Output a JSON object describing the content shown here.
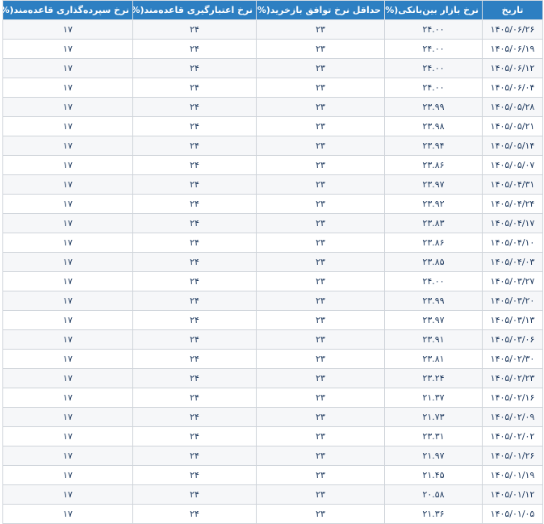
{
  "table": {
    "headers": {
      "date": "تاریخ",
      "interbank": "نرخ بازار بین‌بانکی(%)",
      "repo_min": "حداقل نرخ توافق بازخرید(%)",
      "credit": "نرخ اعتبارگیری قاعده‌مند(%)",
      "deposit": "نرخ سپرده‌گذاری قاعده‌مند(%)"
    },
    "rows": [
      {
        "date": "۱۴۰۵/۰۶/۲۶",
        "interbank": "۲۴.۰۰",
        "repo_min": "۲۳",
        "credit": "۲۴",
        "deposit": "۱۷"
      },
      {
        "date": "۱۴۰۵/۰۶/۱۹",
        "interbank": "۲۴.۰۰",
        "repo_min": "۲۳",
        "credit": "۲۴",
        "deposit": "۱۷"
      },
      {
        "date": "۱۴۰۵/۰۶/۱۲",
        "interbank": "۲۴.۰۰",
        "repo_min": "۲۳",
        "credit": "۲۴",
        "deposit": "۱۷"
      },
      {
        "date": "۱۴۰۵/۰۶/۰۴",
        "interbank": "۲۴.۰۰",
        "repo_min": "۲۳",
        "credit": "۲۴",
        "deposit": "۱۷"
      },
      {
        "date": "۱۴۰۵/۰۵/۲۸",
        "interbank": "۲۳.۹۹",
        "repo_min": "۲۳",
        "credit": "۲۴",
        "deposit": "۱۷"
      },
      {
        "date": "۱۴۰۵/۰۵/۲۱",
        "interbank": "۲۳.۹۸",
        "repo_min": "۲۳",
        "credit": "۲۴",
        "deposit": "۱۷"
      },
      {
        "date": "۱۴۰۵/۰۵/۱۴",
        "interbank": "۲۳.۹۴",
        "repo_min": "۲۳",
        "credit": "۲۴",
        "deposit": "۱۷"
      },
      {
        "date": "۱۴۰۵/۰۵/۰۷",
        "interbank": "۲۳.۸۶",
        "repo_min": "۲۳",
        "credit": "۲۴",
        "deposit": "۱۷"
      },
      {
        "date": "۱۴۰۵/۰۴/۳۱",
        "interbank": "۲۳.۹۷",
        "repo_min": "۲۳",
        "credit": "۲۴",
        "deposit": "۱۷"
      },
      {
        "date": "۱۴۰۵/۰۴/۲۴",
        "interbank": "۲۳.۹۲",
        "repo_min": "۲۳",
        "credit": "۲۴",
        "deposit": "۱۷"
      },
      {
        "date": "۱۴۰۵/۰۴/۱۷",
        "interbank": "۲۳.۸۳",
        "repo_min": "۲۳",
        "credit": "۲۴",
        "deposit": "۱۷"
      },
      {
        "date": "۱۴۰۵/۰۴/۱۰",
        "interbank": "۲۳.۸۶",
        "repo_min": "۲۳",
        "credit": "۲۴",
        "deposit": "۱۷"
      },
      {
        "date": "۱۴۰۵/۰۴/۰۳",
        "interbank": "۲۳.۸۵",
        "repo_min": "۲۳",
        "credit": "۲۴",
        "deposit": "۱۷"
      },
      {
        "date": "۱۴۰۵/۰۳/۲۷",
        "interbank": "۲۴.۰۰",
        "repo_min": "۲۳",
        "credit": "۲۴",
        "deposit": "۱۷"
      },
      {
        "date": "۱۴۰۵/۰۳/۲۰",
        "interbank": "۲۳.۹۹",
        "repo_min": "۲۳",
        "credit": "۲۴",
        "deposit": "۱۷"
      },
      {
        "date": "۱۴۰۵/۰۳/۱۳",
        "interbank": "۲۳.۹۷",
        "repo_min": "۲۳",
        "credit": "۲۴",
        "deposit": "۱۷"
      },
      {
        "date": "۱۴۰۵/۰۳/۰۶",
        "interbank": "۲۳.۹۱",
        "repo_min": "۲۳",
        "credit": "۲۴",
        "deposit": "۱۷"
      },
      {
        "date": "۱۴۰۵/۰۲/۳۰",
        "interbank": "۲۳.۸۱",
        "repo_min": "۲۳",
        "credit": "۲۴",
        "deposit": "۱۷"
      },
      {
        "date": "۱۴۰۵/۰۲/۲۳",
        "interbank": "۲۳.۲۴",
        "repo_min": "۲۳",
        "credit": "۲۴",
        "deposit": "۱۷"
      },
      {
        "date": "۱۴۰۵/۰۲/۱۶",
        "interbank": "۲۱.۳۷",
        "repo_min": "۲۳",
        "credit": "۲۴",
        "deposit": "۱۷"
      },
      {
        "date": "۱۴۰۵/۰۲/۰۹",
        "interbank": "۲۱.۷۳",
        "repo_min": "۲۳",
        "credit": "۲۴",
        "deposit": "۱۷"
      },
      {
        "date": "۱۴۰۵/۰۲/۰۲",
        "interbank": "۲۳.۳۱",
        "repo_min": "۲۳",
        "credit": "۲۴",
        "deposit": "۱۷"
      },
      {
        "date": "۱۴۰۵/۰۱/۲۶",
        "interbank": "۲۱.۹۷",
        "repo_min": "۲۳",
        "credit": "۲۴",
        "deposit": "۱۷"
      },
      {
        "date": "۱۴۰۵/۰۱/۱۹",
        "interbank": "۲۱.۴۵",
        "repo_min": "۲۳",
        "credit": "۲۴",
        "deposit": "۱۷"
      },
      {
        "date": "۱۴۰۵/۰۱/۱۲",
        "interbank": "۲۰.۵۸",
        "repo_min": "۲۳",
        "credit": "۲۴",
        "deposit": "۱۷"
      },
      {
        "date": "۱۴۰۵/۰۱/۰۵",
        "interbank": "۲۱.۳۶",
        "repo_min": "۲۳",
        "credit": "۲۴",
        "deposit": "۱۷"
      }
    ]
  },
  "colors": {
    "header_bg": "#2d7fc2",
    "header_text": "#ffffff",
    "cell_text": "#1f3a5f",
    "row_alt_bg": "#f6f7f9",
    "border": "#cfd4da"
  }
}
